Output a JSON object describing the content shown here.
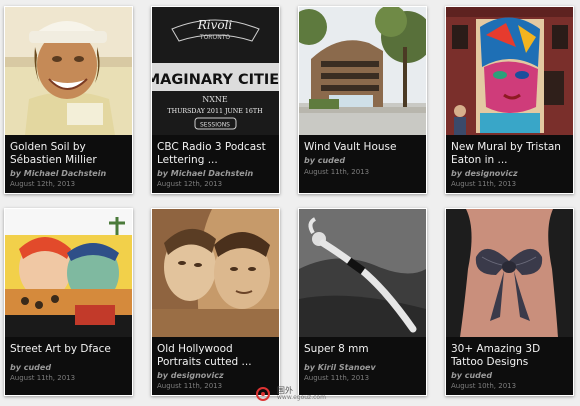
{
  "cards": [
    {
      "title": "Golden Soil by Sébastien Millier",
      "author": "by Michael Dachstein",
      "date": "August 12th, 2013",
      "image": "portrait-man-hardhat"
    },
    {
      "title": "CBC Radio 3 Podcast Lettering ...",
      "author": "by Michael Dachstein",
      "date": "August 12th, 2013",
      "image": "imaginary-cities-poster"
    },
    {
      "title": "Wind Vault House",
      "author": "by cuded",
      "date": "August 11th, 2013",
      "image": "modern-house"
    },
    {
      "title": "New Mural by Tristan Eaton in ...",
      "author": "by designovicz",
      "date": "August 11th, 2013",
      "image": "colorful-mural"
    },
    {
      "title": "Street Art by Dface",
      "author": "by cuded",
      "date": "August 11th, 2013",
      "image": "pop-art-street"
    },
    {
      "title": "Old Hollywood Portraits cutted ...",
      "author": "by designovicz",
      "date": "August 11th, 2013",
      "image": "cardboard-portrait"
    },
    {
      "title": "Super 8 mm",
      "author": "by Kiril Stanoev",
      "date": "August 11th, 2013",
      "image": "bw-woman-rocks"
    },
    {
      "title": "30+ Amazing 3D Tattoo Designs",
      "author": "by cuded",
      "date": "August 10th, 2013",
      "image": "bow-tattoo"
    }
  ],
  "poster": {
    "line1": "Rivoli",
    "line2": "TORONTO",
    "line3": "IMAGINARY CITIES",
    "line4": "NXNE",
    "line5": "THURSDAY 2011 JUNE 16TH",
    "line6": "SESSIONS"
  },
  "watermark": {
    "text": "国外",
    "url": "www.egouz.com"
  }
}
